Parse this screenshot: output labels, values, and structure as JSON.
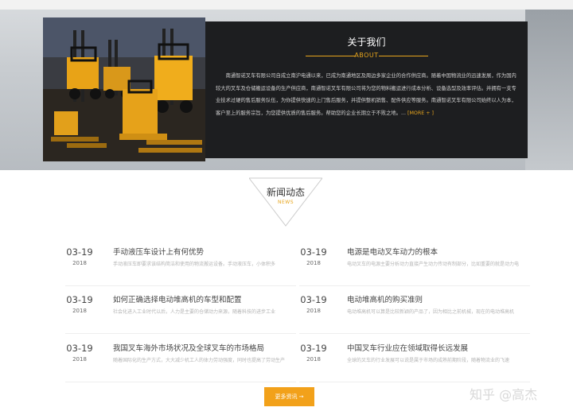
{
  "about": {
    "title": "关于我们",
    "subtitle": "ABOUT",
    "body": "南通智诺叉车有限公司自成立南沪电通以来，已成为南通地区及周边多家企业的合作供应商。随着中国物流业的迅速发展，作为国内较大的叉车及仓储搬运设备的生产供应商，南通智诺叉车有限公司将为您的物料搬运进行成本分析、设备选型及效率评估。并拥有一支专业技术过硬的售后服务队伍，为你提供快速的上门售后服务，并提供整机销售、配件供应等服务。南通智诺叉车有限公司始终以人为本，客户至上的服务宗旨，为您提供优质的售后服务。帮助您的企业长期立于不败之地。...",
    "more_label": "[MORE + ]"
  },
  "news": {
    "title": "新闻动态",
    "subtitle": "NEWS",
    "items": [
      {
        "day": "03-19",
        "year": "2018",
        "title": "手动液压车设计上有何优势",
        "summary": "手动液压车即要求该结构简洁和使用的物流搬运设备。手动液压车，小体积多"
      },
      {
        "day": "03-19",
        "year": "2018",
        "title": "电源是电动叉车动力的根本",
        "summary": "电动叉车的电源主要分析动力直接产生动力传动有制部分，比如重要的就是动力电"
      },
      {
        "day": "03-19",
        "year": "2018",
        "title": "如何正确选择电动堆高机的车型和配置",
        "summary": "社会化进入工业时代以后，人力是主要的仓储动力来源，随着科技的进步工业"
      },
      {
        "day": "03-19",
        "year": "2018",
        "title": "电动堆高机的购买准则",
        "summary": "电动堆高机可以算是比较新颖的产品了，因为相比之前机械，现在的电动堆高机"
      },
      {
        "day": "03-19",
        "year": "2018",
        "title": "我国叉车海外市场状况及全球叉车的市场格局",
        "summary": "随着国际化的生产方式，大大减少机工人的体力劳动强度，同时也提高了劳动生产"
      },
      {
        "day": "03-19",
        "year": "2018",
        "title": "中国叉车行业应在领域取得长远发展",
        "summary": "全球的叉车的行业发展可以说是属于市场的成熟前期阶段，随着物流业的飞速"
      }
    ],
    "more_button": "更多资讯 →"
  },
  "watermark": "知乎 @高杰",
  "colors": {
    "accent": "#e7a51c",
    "panel": "#1d1e20",
    "button": "#f2a11a"
  }
}
